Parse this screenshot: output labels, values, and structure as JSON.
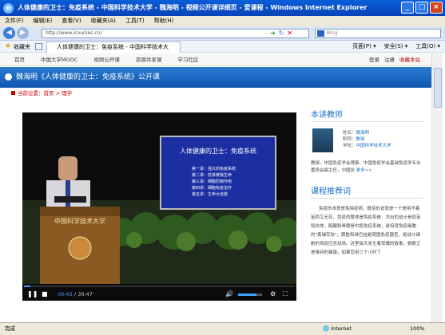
{
  "window": {
    "title": "人体健康的卫士：免疫系统 - 中国科学技术大学 - 魏海明 - 视频公开课详细页 - 爱课程 - Windows Internet Explorer"
  },
  "menu": [
    "文件(F)",
    "编辑(E)",
    "查看(V)",
    "收藏夹(A)",
    "工具(T)",
    "帮助(H)"
  ],
  "address": {
    "url": "http://www.icourses.cn/",
    "search_placeholder": "Bing"
  },
  "favorites": {
    "label": "收藏夹",
    "tab_title": "人体健康的卫士：免疫系统 - 中国科学技术大",
    "cmd": [
      "页面(P) ▾",
      "安全(S) ▾",
      "工具(O) ▾"
    ]
  },
  "sitenav": {
    "links": [
      "首页",
      "中国大学MOOC",
      "视频公开课",
      "资源共享课",
      "学习社区"
    ],
    "login": "登录",
    "register": "注册",
    "collect": "收藏本站"
  },
  "course": {
    "title": "魏海明《人体健康的卫士：免疫系统》公开课"
  },
  "breadcrumb": {
    "prefix": "当前位置：",
    "home": "首页",
    "sep": ">",
    "current": "理学"
  },
  "video": {
    "slide_title": "人体健康的卫士：免疫系统",
    "slide_items": [
      "第一讲：强大的免疫系统",
      "第二讲：抗体被我生命",
      "第三讲：细胞防御作用",
      "第四讲：细胞免疫治疗",
      "第五讲：生命大自救"
    ],
    "podium_text": "中国科学技术大学",
    "current_time": "00:43",
    "separator": "/",
    "total_time": "30:47",
    "progress_fraction": 0.023,
    "volume_fraction": 0.75
  },
  "teacher": {
    "section_title": "本讲教师",
    "name_label": "姓名：",
    "name": "魏海明",
    "title_label": "职称：",
    "title": "教授",
    "school_label": "学校：",
    "school": "中国科学技术大学",
    "bio": "教授，中国免疫学会理事，中国免疫学会基础免疫学专业委员会副主任，中国抗",
    "more": "更多>>"
  },
  "intro": {
    "section_title": "课程推荐词",
    "text": "免疫的本意是免除疫病，概括的说就是一个是用不着苗而艾无花。免疫的整体是免疫系统，杰出的战士是疫苗和抗体，胸腺和骨髓是中枢免疫系统，是培育免疫细胞的\"黄埔军校\"；脾脏和淋巴结是周围免疫器官，是战斗细胞的免疫应答战场。这里每天发生着惊魄的故事，数数正是维持的健康。如果您用三个小时了"
  },
  "status": {
    "left": "完成",
    "zone": "Internet",
    "zoom": "100%"
  }
}
